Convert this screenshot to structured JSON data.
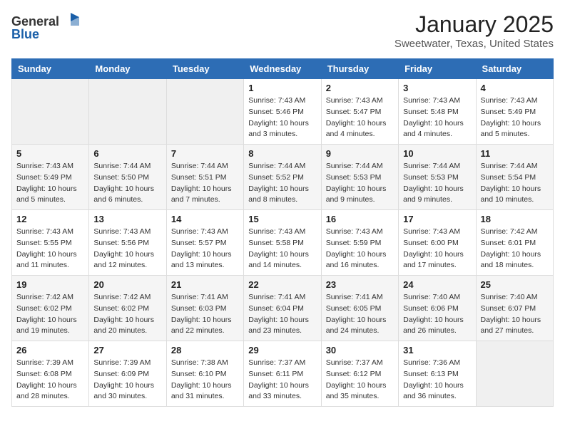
{
  "header": {
    "logo_general": "General",
    "logo_blue": "Blue",
    "month_title": "January 2025",
    "location": "Sweetwater, Texas, United States"
  },
  "weekdays": [
    "Sunday",
    "Monday",
    "Tuesday",
    "Wednesday",
    "Thursday",
    "Friday",
    "Saturday"
  ],
  "weeks": [
    [
      {
        "day": "",
        "info": ""
      },
      {
        "day": "",
        "info": ""
      },
      {
        "day": "",
        "info": ""
      },
      {
        "day": "1",
        "info": "Sunrise: 7:43 AM\nSunset: 5:46 PM\nDaylight: 10 hours\nand 3 minutes."
      },
      {
        "day": "2",
        "info": "Sunrise: 7:43 AM\nSunset: 5:47 PM\nDaylight: 10 hours\nand 4 minutes."
      },
      {
        "day": "3",
        "info": "Sunrise: 7:43 AM\nSunset: 5:48 PM\nDaylight: 10 hours\nand 4 minutes."
      },
      {
        "day": "4",
        "info": "Sunrise: 7:43 AM\nSunset: 5:49 PM\nDaylight: 10 hours\nand 5 minutes."
      }
    ],
    [
      {
        "day": "5",
        "info": "Sunrise: 7:43 AM\nSunset: 5:49 PM\nDaylight: 10 hours\nand 5 minutes."
      },
      {
        "day": "6",
        "info": "Sunrise: 7:44 AM\nSunset: 5:50 PM\nDaylight: 10 hours\nand 6 minutes."
      },
      {
        "day": "7",
        "info": "Sunrise: 7:44 AM\nSunset: 5:51 PM\nDaylight: 10 hours\nand 7 minutes."
      },
      {
        "day": "8",
        "info": "Sunrise: 7:44 AM\nSunset: 5:52 PM\nDaylight: 10 hours\nand 8 minutes."
      },
      {
        "day": "9",
        "info": "Sunrise: 7:44 AM\nSunset: 5:53 PM\nDaylight: 10 hours\nand 9 minutes."
      },
      {
        "day": "10",
        "info": "Sunrise: 7:44 AM\nSunset: 5:53 PM\nDaylight: 10 hours\nand 9 minutes."
      },
      {
        "day": "11",
        "info": "Sunrise: 7:44 AM\nSunset: 5:54 PM\nDaylight: 10 hours\nand 10 minutes."
      }
    ],
    [
      {
        "day": "12",
        "info": "Sunrise: 7:43 AM\nSunset: 5:55 PM\nDaylight: 10 hours\nand 11 minutes."
      },
      {
        "day": "13",
        "info": "Sunrise: 7:43 AM\nSunset: 5:56 PM\nDaylight: 10 hours\nand 12 minutes."
      },
      {
        "day": "14",
        "info": "Sunrise: 7:43 AM\nSunset: 5:57 PM\nDaylight: 10 hours\nand 13 minutes."
      },
      {
        "day": "15",
        "info": "Sunrise: 7:43 AM\nSunset: 5:58 PM\nDaylight: 10 hours\nand 14 minutes."
      },
      {
        "day": "16",
        "info": "Sunrise: 7:43 AM\nSunset: 5:59 PM\nDaylight: 10 hours\nand 16 minutes."
      },
      {
        "day": "17",
        "info": "Sunrise: 7:43 AM\nSunset: 6:00 PM\nDaylight: 10 hours\nand 17 minutes."
      },
      {
        "day": "18",
        "info": "Sunrise: 7:42 AM\nSunset: 6:01 PM\nDaylight: 10 hours\nand 18 minutes."
      }
    ],
    [
      {
        "day": "19",
        "info": "Sunrise: 7:42 AM\nSunset: 6:02 PM\nDaylight: 10 hours\nand 19 minutes."
      },
      {
        "day": "20",
        "info": "Sunrise: 7:42 AM\nSunset: 6:02 PM\nDaylight: 10 hours\nand 20 minutes."
      },
      {
        "day": "21",
        "info": "Sunrise: 7:41 AM\nSunset: 6:03 PM\nDaylight: 10 hours\nand 22 minutes."
      },
      {
        "day": "22",
        "info": "Sunrise: 7:41 AM\nSunset: 6:04 PM\nDaylight: 10 hours\nand 23 minutes."
      },
      {
        "day": "23",
        "info": "Sunrise: 7:41 AM\nSunset: 6:05 PM\nDaylight: 10 hours\nand 24 minutes."
      },
      {
        "day": "24",
        "info": "Sunrise: 7:40 AM\nSunset: 6:06 PM\nDaylight: 10 hours\nand 26 minutes."
      },
      {
        "day": "25",
        "info": "Sunrise: 7:40 AM\nSunset: 6:07 PM\nDaylight: 10 hours\nand 27 minutes."
      }
    ],
    [
      {
        "day": "26",
        "info": "Sunrise: 7:39 AM\nSunset: 6:08 PM\nDaylight: 10 hours\nand 28 minutes."
      },
      {
        "day": "27",
        "info": "Sunrise: 7:39 AM\nSunset: 6:09 PM\nDaylight: 10 hours\nand 30 minutes."
      },
      {
        "day": "28",
        "info": "Sunrise: 7:38 AM\nSunset: 6:10 PM\nDaylight: 10 hours\nand 31 minutes."
      },
      {
        "day": "29",
        "info": "Sunrise: 7:37 AM\nSunset: 6:11 PM\nDaylight: 10 hours\nand 33 minutes."
      },
      {
        "day": "30",
        "info": "Sunrise: 7:37 AM\nSunset: 6:12 PM\nDaylight: 10 hours\nand 35 minutes."
      },
      {
        "day": "31",
        "info": "Sunrise: 7:36 AM\nSunset: 6:13 PM\nDaylight: 10 hours\nand 36 minutes."
      },
      {
        "day": "",
        "info": ""
      }
    ]
  ]
}
